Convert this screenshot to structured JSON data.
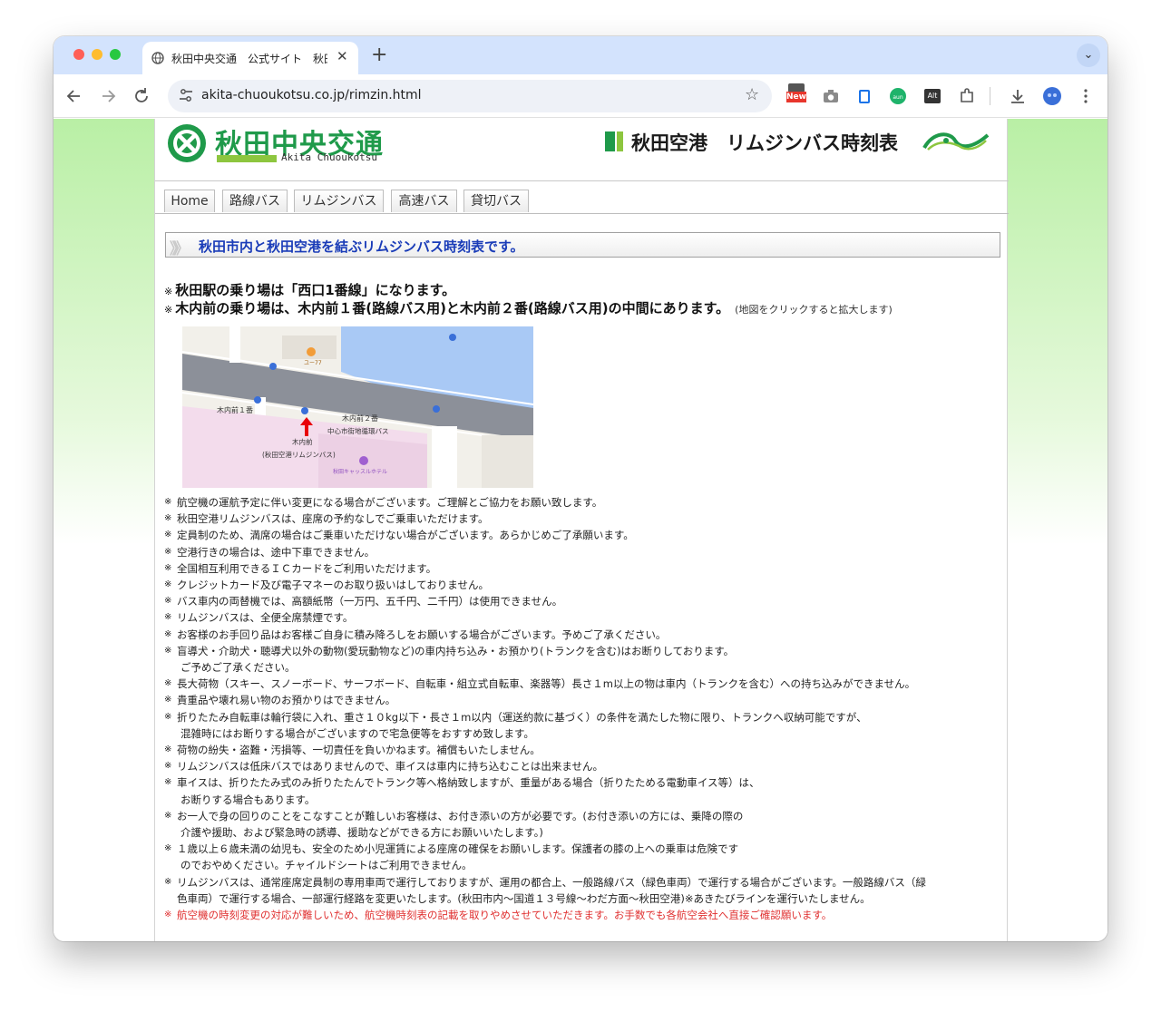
{
  "browser": {
    "tab_title": "秋田中央交通　公式サイト　秋田",
    "close_symbol": "✕",
    "new_tab_symbol": "+",
    "tab_menu_symbol": "⌄",
    "url": "akita-chuoukotsu.co.jp/rimzin.html",
    "new_badge": "New",
    "alt_label": "Alt"
  },
  "header": {
    "logo_text": "秋田中央交通",
    "logo_roman": "Akita Chuoukotsu",
    "page_title": "秋田空港　リムジンバス時刻表"
  },
  "nav": {
    "tabs": [
      "Home",
      "路線バス",
      "リムジンバス",
      "高速バス",
      "貸切バス"
    ]
  },
  "banner": {
    "text": "秋田市内と秋田空港を結ぶリムジンバス時刻表です。"
  },
  "boarding": {
    "mark": "※",
    "line1": "秋田駅の乗り場は「西口1番線」になります。",
    "line2": "木内前の乗り場は、木内前１番(路線バス用)と木内前２番(路線バス用)の中間にあります。",
    "line2_note": "(地図をクリックすると拡大します)"
  },
  "map": {
    "label_kiuchi1": "木内前１番",
    "label_kiuchi2": "木内前２番",
    "label_kiuchi": "木内前",
    "label_limousine": "(秋田空港リムジンバス)",
    "label_loop_bus": "中心市街地循環バス",
    "label_hotel": "秋田キャッスルホテル",
    "label_yutori": "ユー77"
  },
  "notes": [
    {
      "text": "航空機の運航予定に伴い変更になる場合がございます。ご理解とご協力をお願い致します。"
    },
    {
      "text": "秋田空港リムジンバスは、座席の予約なしでご乗車いただけます。"
    },
    {
      "text": "定員制のため、満席の場合はご乗車いただけない場合がございます。あらかじめご了承願います。"
    },
    {
      "text": "空港行きの場合は、途中下車できません。"
    },
    {
      "text": "全国相互利用できるＩＣカードをご利用いただけます。"
    },
    {
      "text": "クレジットカード及び電子マネーのお取り扱いはしておりません。"
    },
    {
      "text": "バス車内の両替機では、高額紙幣（一万円、五千円、二千円）は使用できません。"
    },
    {
      "text": "リムジンバスは、全便全席禁煙です。"
    },
    {
      "text": "お客様のお手回り品はお客様ご自身に積み降ろしをお願いする場合がございます。予めご了承ください。"
    },
    {
      "text": "盲導犬・介助犬・聴導犬以外の動物(愛玩動物など)の車内持ち込み・お預かり(トランクを含む)はお断りしております。",
      "text2": "ご予めご了承ください。"
    },
    {
      "text": "長大荷物（スキー、スノーボード、サーフボード、自転車・組立式自転車、楽器等）長さ１m以上の物は車内（トランクを含む）への持ち込みができません。"
    },
    {
      "text": "貴重品や壊れ易い物のお預かりはできません。"
    },
    {
      "text": "折りたたみ自転車は輪行袋に入れ、重さ１０kg以下・長さ１m以内（運送約款に基づく）の条件を満たした物に限り、トランクへ収納可能ですが、",
      "text2": "混雑時にはお断りする場合がございますので宅急便等をおすすめ致します。"
    },
    {
      "text": "荷物の紛失・盗難・汚損等、一切責任を負いかねます。補償もいたしません。"
    },
    {
      "text": "リムジンバスは低床バスではありませんので、車イスは車内に持ち込むことは出来ません。"
    },
    {
      "text": "車イスは、折りたたみ式のみ折りたたんでトランク等へ格納致しますが、重量がある場合（折りたためる電動車イス等）は、",
      "text2": "お断りする場合もあります。"
    },
    {
      "text": "お一人で身の回りのことをこなすことが難しいお客様は、お付き添いの方が必要です。(お付き添いの方には、乗降の際の",
      "text2": "介護や援助、および緊急時の誘導、援助などができる方にお願いいたします。)"
    },
    {
      "text": "１歳以上６歳未満の幼児も、安全のため小児運賃による座席の確保をお願いします。保護者の膝の上への乗車は危険です",
      "text2": "のでおやめください。チャイルドシートはご利用できません。"
    },
    {
      "text": "リムジンバスは、通常座席定員制の専用車両で運行しておりますが、運用の都合上、一般路線バス（緑色車両）で運行する場合がございます。一般路線バス（緑",
      "text2": "色車両）で運行する場合、一部運行経路を変更いたします。(秋田市内〜国道１３号線〜わだ方面〜秋田空港)※あきたびラインを運行いたしません。"
    },
    {
      "text": "航空機の時刻変更の対応が難しいため、航空機時刻表の記載を取りやめさせていただきます。お手数でも各航空会社へ直接ご確認願います。",
      "red": true
    }
  ],
  "note_mark": "※",
  "colors": {
    "brand_green": "#1f9a4a",
    "accent_lime": "#8dc63f",
    "banner_blue": "#1a3cb8",
    "warning_red": "#e03030"
  }
}
